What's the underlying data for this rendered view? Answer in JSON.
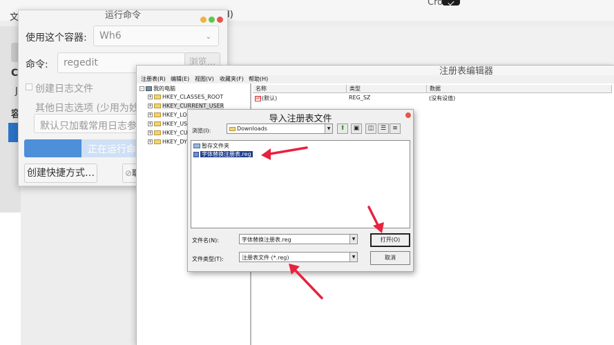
{
  "background": {
    "title_partial": "Cro    ver",
    "menu_left": "文",
    "menu_right": "H)",
    "left_letters": [
      "C",
      "J",
      "容"
    ]
  },
  "run_dialog": {
    "title": "运行命令",
    "container_label": "使用这个容器:",
    "container_value": "Wh6",
    "command_label": "命令:",
    "command_value": "regedit",
    "browse_label": "浏览…",
    "log_checkbox_label": "创建日志文件",
    "log_checkbox_checked": false,
    "other_log_label": "其他日志选项 (少用为妙",
    "other_log_placeholder": "默认只加载常用日志参",
    "run_button_label": "正在运行命令",
    "run_progress_fraction": 0.32,
    "shortcut_button_label": "创建快捷方式…",
    "right_button_label": "取"
  },
  "regedit": {
    "title": "注册表编辑器",
    "menu": [
      "注册表(R)",
      "编辑(E)",
      "视图(V)",
      "收藏夹(F)",
      "帮助(H)"
    ],
    "tree_root": "我的电脑",
    "tree_items": [
      "HKEY_CLASSES_ROOT",
      "HKEY_CURRENT_USER",
      "HKEY_LO",
      "HKEY_US",
      "HKEY_CU",
      "HKEY_DY"
    ],
    "columns": [
      "名称",
      "类型",
      "数据"
    ],
    "rows": [
      {
        "name": "(默认)",
        "type": "REG_SZ",
        "data": "(没有设值)"
      }
    ]
  },
  "import_dialog": {
    "title": "导入注册表文件",
    "look_in_label": "浏览(I):",
    "look_in_value": "Downloads",
    "files": [
      {
        "name": "暂存文件夹",
        "kind": "folder",
        "selected": false
      },
      {
        "name": "字体替换注册表.reg",
        "kind": "reg",
        "selected": true
      }
    ],
    "filename_label": "文件名(N):",
    "filename_value": "字体替换注册表.reg",
    "filetype_label": "文件类型(T):",
    "filetype_value": "注册表文件 (*.reg)",
    "open_button": "打开(O)",
    "cancel_button": "取消"
  },
  "annotation_color": "#e8213f"
}
